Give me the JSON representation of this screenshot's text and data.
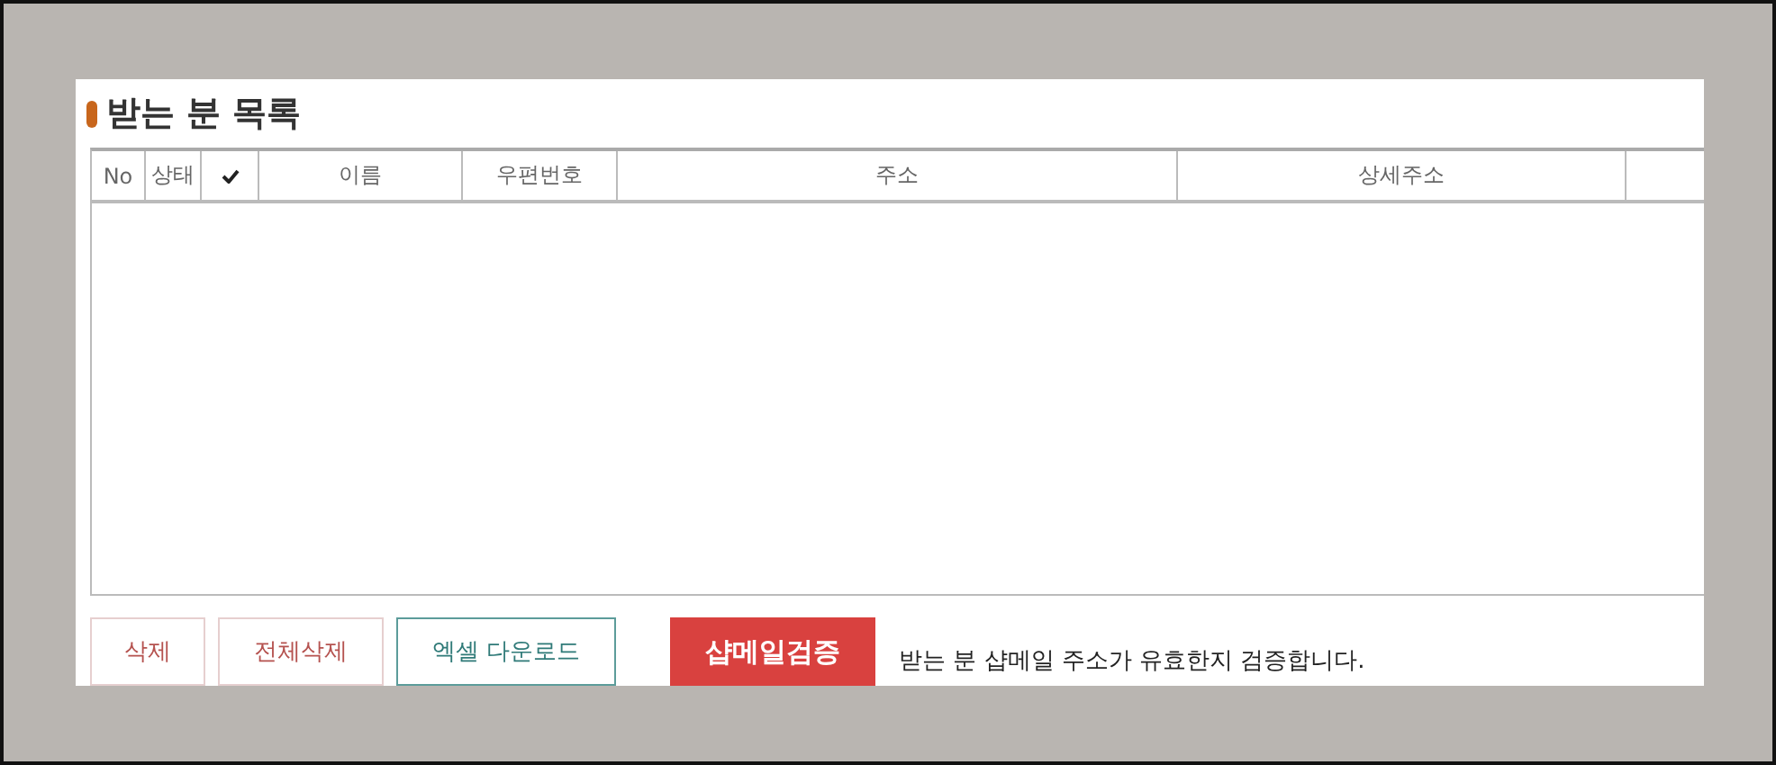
{
  "section": {
    "title": "받는 분 목록"
  },
  "table": {
    "columns": [
      {
        "kind": "text",
        "label": "No"
      },
      {
        "kind": "text",
        "label": "상태"
      },
      {
        "kind": "check"
      },
      {
        "kind": "text",
        "label": "이름"
      },
      {
        "kind": "text",
        "label": "우편번호"
      },
      {
        "kind": "text",
        "label": "주소"
      },
      {
        "kind": "text",
        "label": "상세주소"
      },
      {
        "kind": "blank"
      }
    ]
  },
  "buttons": [
    {
      "kind": "outline",
      "label": "삭제",
      "color": "#b5524f"
    },
    {
      "kind": "outline",
      "label": "전체삭제",
      "color": "#b5524f"
    },
    {
      "kind": "outline",
      "label": "엑셀 다운로드",
      "color": "#2f7a78"
    },
    {
      "kind": "solid",
      "label": "샵메일검증",
      "color": "#d9413f"
    }
  ],
  "note": "받는 분 샵메일 주소가 유효한지 검증합니다."
}
